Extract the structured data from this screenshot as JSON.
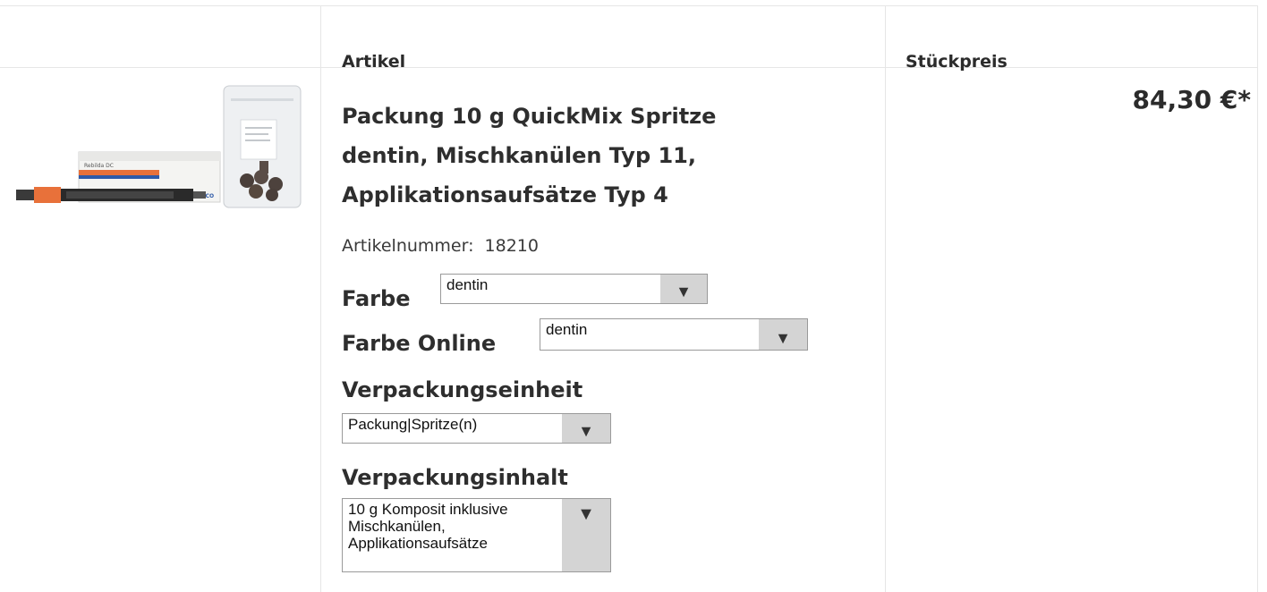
{
  "table": {
    "headers": {
      "article": "Artikel",
      "unit_price": "Stückpreis"
    }
  },
  "product": {
    "title_lines": [
      "Packung 10 g QuickMix Spritze",
      "dentin, Mischkanülen Typ 11,",
      "Applikationsaufsätze Typ 4"
    ],
    "article_number_label": "Artikelnummer:",
    "article_number": "18210",
    "price": "84,30 €*",
    "image_labels": {
      "brand": "VOCO",
      "product": "Rebilda DC"
    }
  },
  "options": {
    "color": {
      "label": "Farbe",
      "value": "dentin"
    },
    "color_online": {
      "label": "Farbe Online",
      "value": "dentin"
    },
    "packaging_unit": {
      "label": "Verpackungseinheit",
      "value": "Packung|Spritze(n)"
    },
    "packaging_content": {
      "label": "Verpackungsinhalt",
      "value": "10 g Komposit inklusive\nMischkanülen,\nApplikationsaufsätze"
    }
  },
  "icons": {
    "dropdown": "triangle-down-icon"
  },
  "colors": {
    "border": "#e6e6e6",
    "select_arrow_bg": "#d4d4d4",
    "box_orange": "#e8713a",
    "box_blue": "#2f5aa8"
  }
}
